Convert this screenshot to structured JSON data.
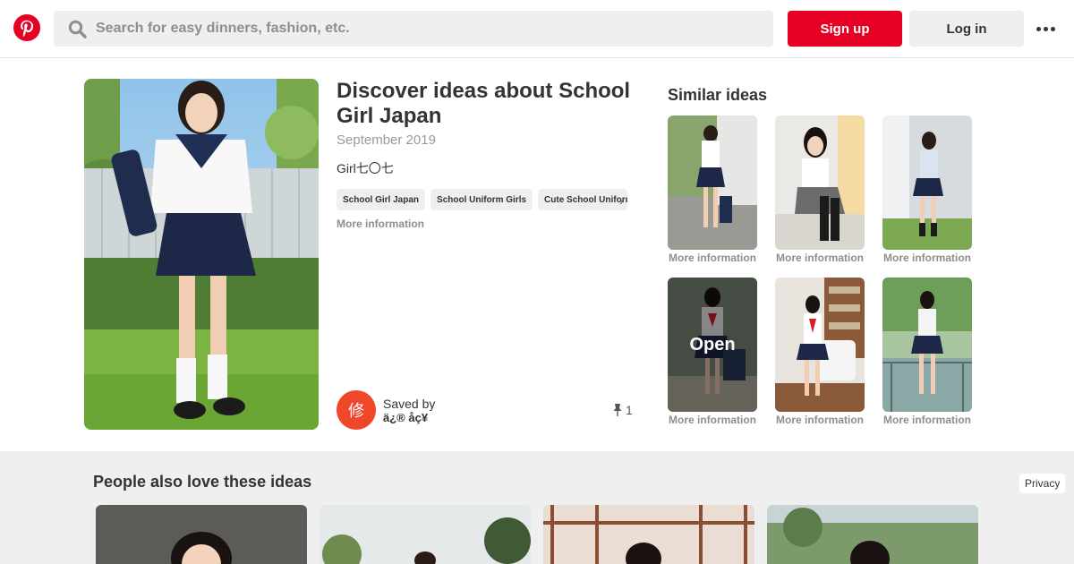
{
  "header": {
    "logo_icon": "pinterest-logo-icon",
    "search_placeholder": "Search for easy dinners, fashion, etc.",
    "signup_label": "Sign up",
    "login_label": "Log in",
    "more_icon": "more-dots-icon",
    "brand_color": "#e60023"
  },
  "pin": {
    "title": "Discover ideas about School Girl Japan",
    "date": "September 2019",
    "description": "Girl七〇七",
    "tags": [
      "School Girl Japan",
      "School Uniform Girls",
      "Cute School Uniform"
    ],
    "more_info": "More information",
    "saved_by_label": "Saved by",
    "saved_by_user": "ä¿® åç¥",
    "avatar_initial": "修",
    "pin_count": "1"
  },
  "similar": {
    "heading": "Similar ideas",
    "items": [
      {
        "caption": "More information"
      },
      {
        "caption": "More information"
      },
      {
        "caption": "More information"
      },
      {
        "caption": "More information",
        "overlay": "Open"
      },
      {
        "caption": "More information"
      },
      {
        "caption": "More information"
      }
    ]
  },
  "bottom": {
    "heading": "People also love these ideas",
    "privacy": "Privacy"
  }
}
